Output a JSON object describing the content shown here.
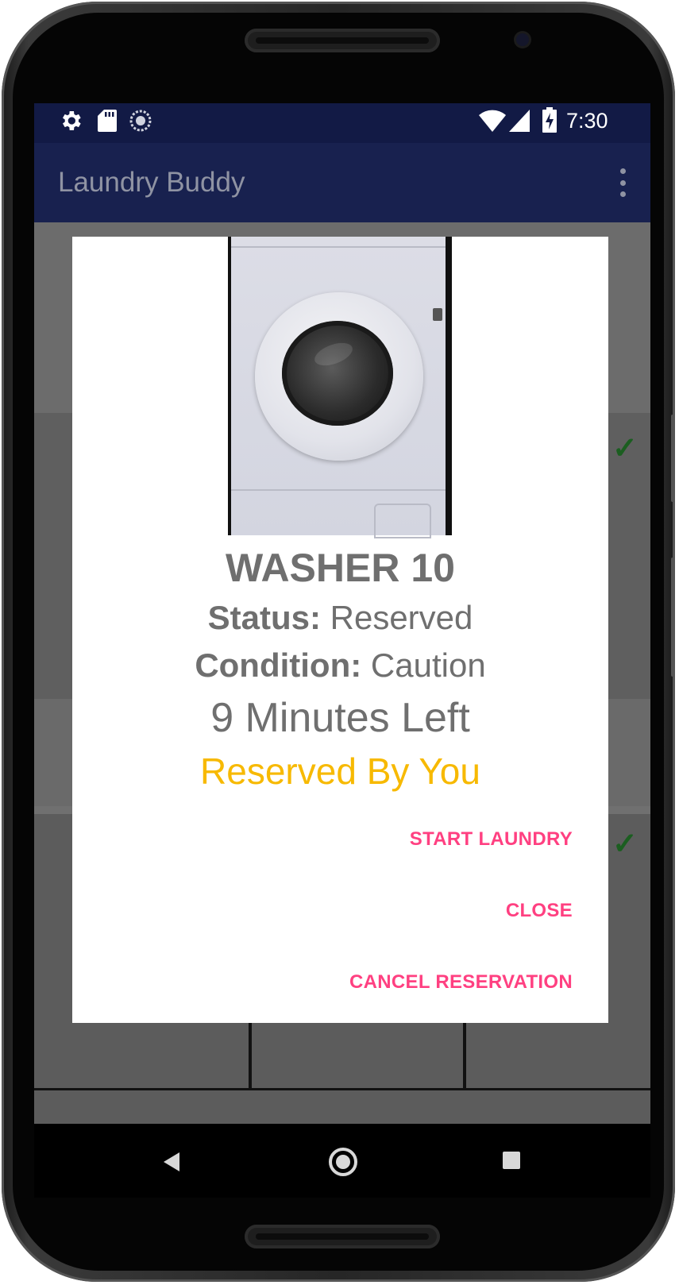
{
  "status_bar": {
    "time": "7:30",
    "left_icons": [
      "gear-icon",
      "sd-card-icon",
      "sync-icon"
    ],
    "right_icons": [
      "wifi-icon",
      "signal-icon",
      "battery-charging-icon"
    ]
  },
  "app_bar": {
    "title": "Laundry Buddy",
    "overflow_icon": "more-vert-icon"
  },
  "dialog": {
    "machine_name": "WASHER 10",
    "status_label": "Status:",
    "status_value": "Reserved",
    "condition_label": "Condition:",
    "condition_value": "Caution",
    "time_left": "9 Minutes Left",
    "reserved_text": "Reserved By You",
    "reserved_color": "#f7b900",
    "accent_color": "#ff4081",
    "buttons": {
      "start": "START LAUNDRY",
      "close": "CLOSE",
      "cancel": "CANCEL RESERVATION"
    }
  },
  "nav_bar": {
    "icons": [
      "back-icon",
      "home-icon",
      "recents-icon"
    ]
  },
  "colors": {
    "primary_dark": "#121a45",
    "primary": "#18214f"
  }
}
